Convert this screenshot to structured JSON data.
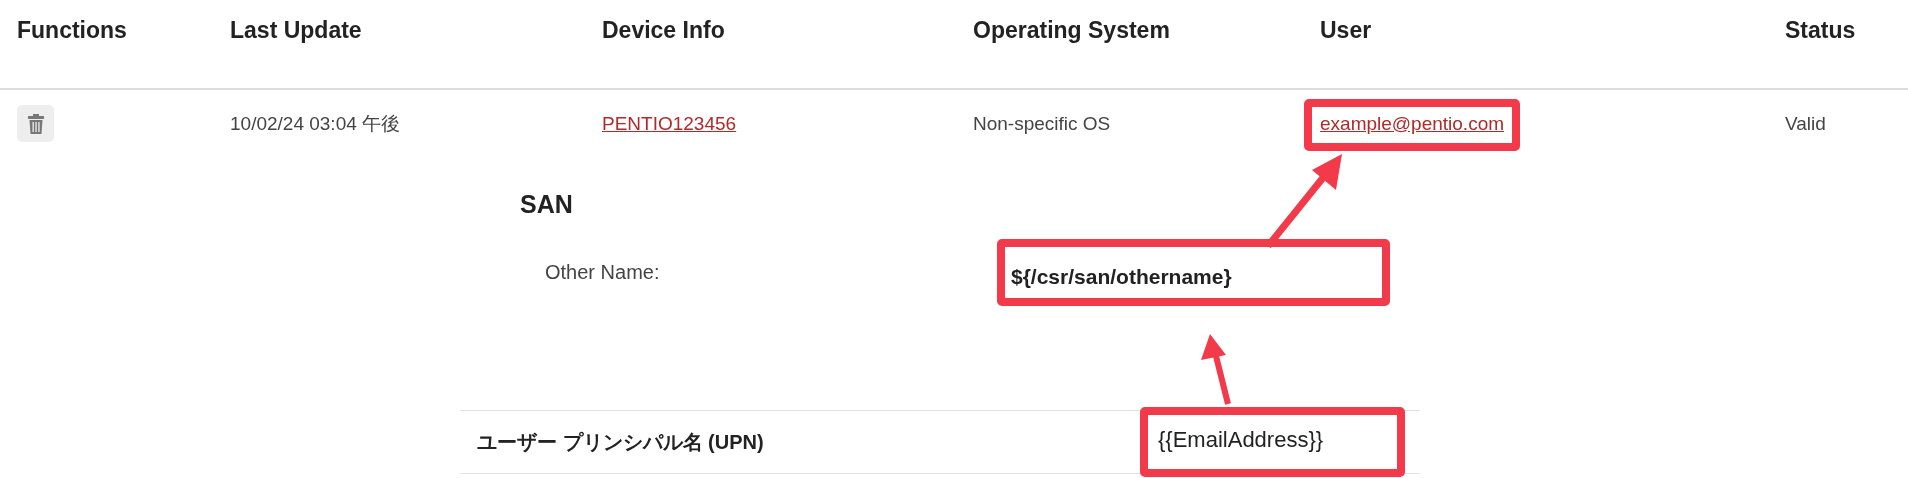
{
  "table": {
    "columns": [
      "Functions",
      "Last Update",
      "Device Info",
      "Operating System",
      "User",
      "Status"
    ],
    "rows": [
      {
        "last_update": "10/02/24 03:04 午後",
        "device_info": "PENTIO123456",
        "operating_system": "Non-specific OS",
        "user": "example@pentio.com",
        "status": "Valid"
      }
    ]
  },
  "details": {
    "title": "SAN",
    "fields": [
      {
        "label": "Other Name:",
        "value": "${/csr/san/othername}"
      }
    ]
  },
  "mapping": {
    "rows": [
      {
        "label": "ユーザー プリンシパル名 (UPN)",
        "value": "{{EmailAddress}}"
      }
    ]
  }
}
